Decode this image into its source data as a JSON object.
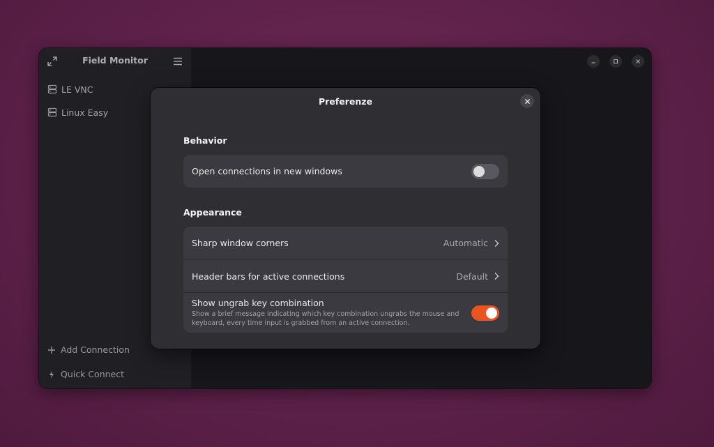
{
  "app": {
    "title": "Field Monitor",
    "connections": [
      "LE VNC",
      "Linux Easy"
    ],
    "add_connection": "Add Connection",
    "quick_connect": "Quick Connect"
  },
  "dialog": {
    "title": "Preferenze",
    "behavior": {
      "heading": "Behavior",
      "open_new_windows": {
        "label": "Open connections in new windows",
        "enabled": false
      }
    },
    "appearance": {
      "heading": "Appearance",
      "sharp_corners": {
        "label": "Sharp window corners",
        "value": "Automatic"
      },
      "header_bars": {
        "label": "Header bars for active connections",
        "value": "Default"
      },
      "ungrab": {
        "label": "Show ungrab key combination",
        "description": "Show a brief message indicating which key combination ungrabs the mouse and keyboard, every time input is grabbed from an active connection.",
        "enabled": true
      }
    }
  },
  "colors": {
    "accent": "#e95420",
    "background": "#5e2149"
  }
}
